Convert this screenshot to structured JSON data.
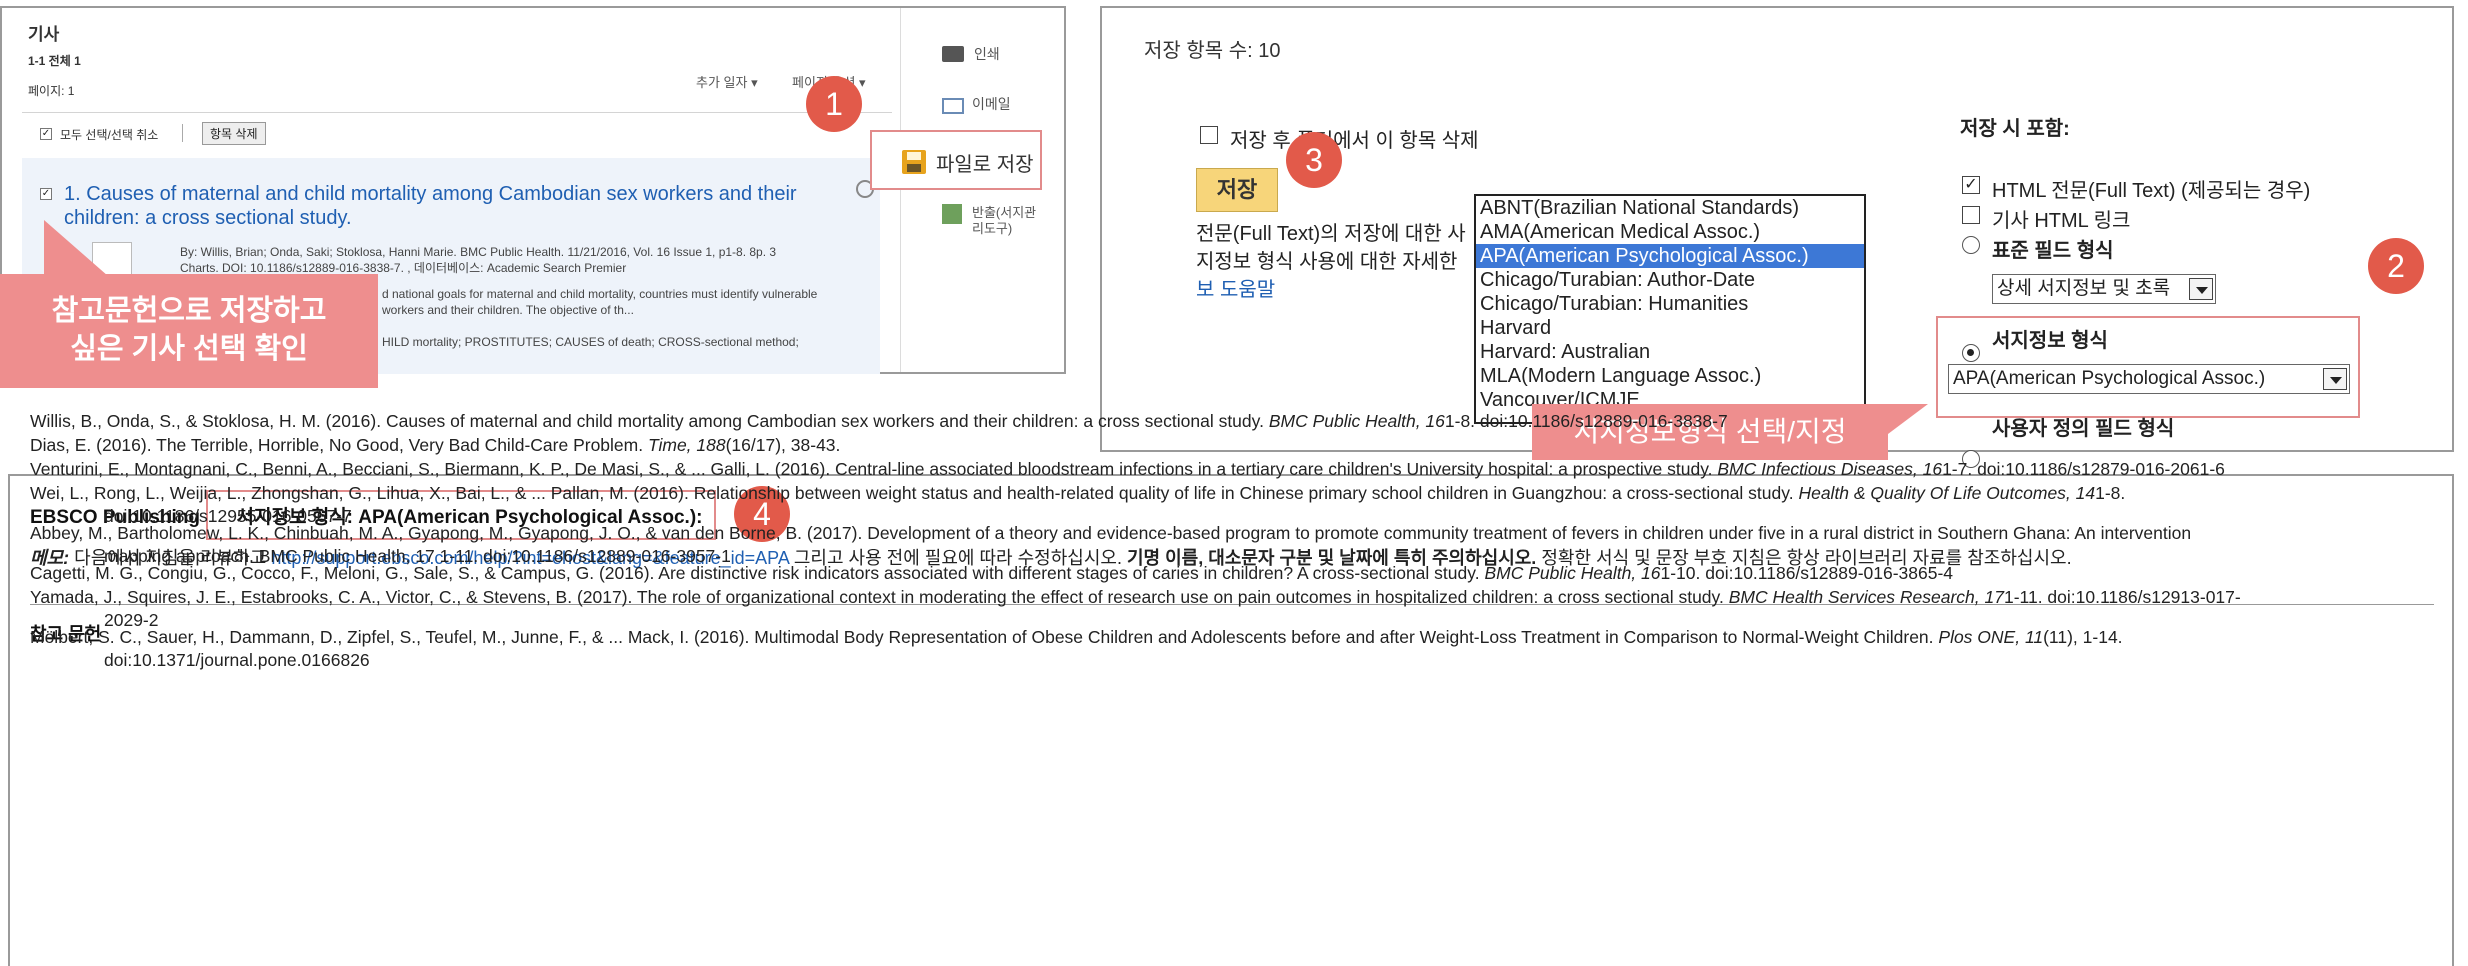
{
  "results": {
    "title": "기사",
    "range": "1-1 전체 1",
    "pages": "페이지: 1",
    "sort_label": "추가 일자",
    "page_options_label": "페이지 옵션",
    "select_all": "모두 선택/선택 취소",
    "delete_button": "항목 삭제",
    "article_title_line1": "1. Causes of maternal and child mortality among Cambodian sex workers and their",
    "article_title_line2": "children: a cross sectional study.",
    "meta_line1": "By: Willis, Brian; Onda, Saki; Stoklosa, Hanni Marie. BMC Public Health. 11/21/2016, Vol. 16 Issue 1, p1-8. 8p. 3",
    "meta_line2": "Charts. DOI: 10.1186/s12889-016-3838-7. , 데이터베이스: Academic Search Premier",
    "meta_line3": "d national goals for maternal and child mortality, countries must identify vulnerable",
    "meta_line4": "workers and their children. The objective of th...",
    "meta_line5": "HILD mortality; PROSTITUTES; CAUSES of death; CROSS-sectional method;",
    "side_print": "인쇄",
    "side_email": "이메일",
    "side_save_file": "파일로 저장",
    "side_export": "반출(서지관",
    "side_export2": "리도구)",
    "callout_line1": "참고문헌으로 저장하고",
    "callout_line2": "싶은 기사 선택 확인"
  },
  "badges": {
    "b1": "1",
    "b2": "2",
    "b3": "3",
    "b4": "4"
  },
  "save_panel": {
    "count_label": "저장 항목 수: 10",
    "delete_after_save": "저장 후 폴더에서 이 항목 삭제",
    "save_button": "저장",
    "help_line1": "전문(Full Text)의 저장에 대한 사",
    "help_line2": "지정보 형식 사용에 대한 자세한",
    "help_link": "보 도움말",
    "include_title": "저장 시 포함:",
    "opt_html_fulltext": "HTML 전문(Full Text) (제공되는 경우)",
    "opt_html_link": "기사 HTML 링크",
    "opt_standard_fields": "표준 필드 형식",
    "standard_fields_select": "상세 서지정보 및 초록",
    "opt_bib_format": "서지정보 형식",
    "bib_format_select": "APA(American Psychological Assoc.)",
    "opt_custom_fields": "사용자 정의 필드 형식",
    "format_list": [
      "ABNT(Brazilian National Standards)",
      "AMA(American Medical Assoc.)",
      "APA(American Psychological Assoc.)",
      "Chicago/Turabian: Author-Date",
      "Chicago/Turabian: Humanities",
      "Harvard",
      "Harvard: Australian",
      "MLA(Modern Language Assoc.)",
      "Vancouver/ICMJE"
    ],
    "format_selected_index": 2,
    "callout": "서지정보형식 선택/지정"
  },
  "citation_panel": {
    "publisher": "EBSCO Publishing",
    "format_heading": "서지정보 형식: APA(American Psychological Assoc.):",
    "memo_label": "메모:",
    "memo_text1": "다음에서 지침을 리뷰하고",
    "memo_link": "http://support.ebsco.com/help/?int=ehost&lang=&feature_id=APA",
    "memo_text2": "그리고 사용 전에 필요에 따라 수정하십시오.",
    "memo_bold": "기명 이름, 대소문자 구분 및 날짜에 특히 주의하십시오.",
    "memo_text3": "정확한 서식 및 문장 부호 지침은 항상 라이브러리 자료를 참조하십시오.",
    "refs_title": "참고 문헌",
    "refs": [
      {
        "a": "Willis, B., Onda, S., & Stoklosa, H. M. (2016). Causes of maternal and child mortality among Cambodian sex workers and their children: a cross sectional study.",
        "j": "BMC Public Health, 16",
        "b": "1-8. doi:10.1186/s12889-016-3838-7",
        "c": ""
      },
      {
        "a": "Dias, E. (2016). The Terrible, Horrible, No Good, Very Bad Child-Care Problem.",
        "j": "Time, 188",
        "b": "(16/17), 38-43.",
        "c": ""
      },
      {
        "a": "Venturini, E., Montagnani, C., Benni, A., Becciani, S., Biermann, K. P., De Masi, S., & ... Galli, L. (2016). Central-line associated bloodstream infections in a tertiary care children's University hospital: a prospective study.",
        "j": "BMC Infectious Diseases, 16",
        "b": "1-7. doi:10.1186/s12879-016-2061-6",
        "c": ""
      },
      {
        "a": "Wei, L., Rong, L., Weijia, L., Zhongshan, G., Lihua, X., Bai, L., & ... Pallan, M. (2016). Relationship between weight status and health-related quality of life in Chinese primary school children in Guangzhou: a cross-sectional study.",
        "j": "Health & Quality Of Life Outcomes, 14",
        "b": "1-8.",
        "c": "doi:10.1186/s12955-016-0567-7"
      },
      {
        "a": "Abbey, M., Bartholomew, L. K., Chinbuah, M. A., Gyapong, M., Gyapong, J. O., & van den Borne, B. (2017). Development of a theory and evidence-based program to promote community treatment of fevers in children under five in a rural district in Southern Ghana: An intervention",
        "j": "",
        "b": "",
        "c": "mapping approach. BMC Public Health, 17 1-11. doi:10.1186/s12889-016-3957-1"
      },
      {
        "a": "Cagetti, M. G., Congiu, G., Cocco, F., Meloni, G., Sale, S., & Campus, G. (2016). Are distinctive risk indicators associated with different stages of caries in children? A cross-sectional study.",
        "j": "BMC Public Health, 16",
        "b": "1-10. doi:10.1186/s12889-016-3865-4",
        "c": ""
      },
      {
        "a": "Yamada, J., Squires, J. E., Estabrooks, C. A., Victor, C., & Stevens, B. (2017). The role of organizational context in moderating the effect of research use on pain outcomes in hospitalized children: a cross sectional study.",
        "j": "BMC Health Services Research, 17",
        "b": "1-11. doi:10.1186/s12913-017-",
        "c": "2029-2"
      },
      {
        "a": "Mölbert, S. C., Sauer, H., Dammann, D., Zipfel, S., Teufel, M., Junne, F., & ... Mack, I. (2016). Multimodal Body Representation of Obese Children and Adolescents before and after Weight-Loss Treatment in Comparison to Normal-Weight Children.",
        "j": "Plos ONE, 11",
        "b": "(11), 1-14.",
        "c": "doi:10.1371/journal.pone.0166826"
      }
    ]
  },
  "colors": {
    "accent_red": "#e25a4a",
    "callout_pink": "#ee8e8e",
    "link_blue": "#1f5fb2",
    "selected_blue": "#3d78d6"
  }
}
